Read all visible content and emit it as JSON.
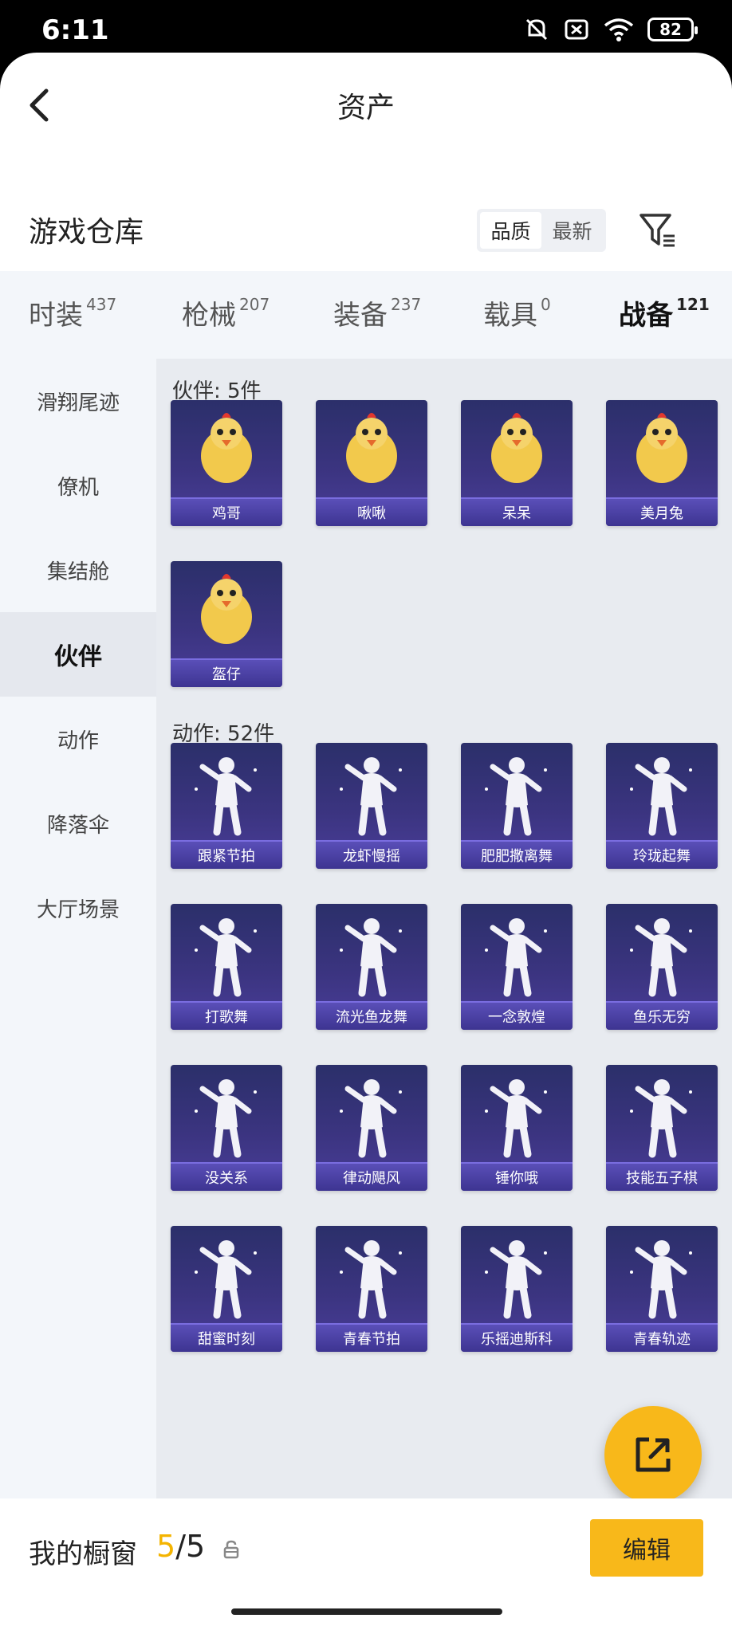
{
  "status": {
    "time": "6:11",
    "battery": "82"
  },
  "header": {
    "title": "资产"
  },
  "warehouse": {
    "title": "游戏仓库",
    "sort_options": [
      "品质",
      "最新"
    ],
    "active_sort": "品质"
  },
  "tabs": [
    {
      "label": "时装",
      "count": "437"
    },
    {
      "label": "枪械",
      "count": "207"
    },
    {
      "label": "装备",
      "count": "237"
    },
    {
      "label": "载具",
      "count": "0"
    },
    {
      "label": "战备",
      "count": "121"
    }
  ],
  "active_tab": "战备",
  "sidebar": {
    "items": [
      "滑翔尾迹",
      "僚机",
      "集结舱",
      "伙伴",
      "动作",
      "降落伞",
      "大厅场景"
    ],
    "active": "伙伴"
  },
  "groups": [
    {
      "title": "伙伴: 5件",
      "items": [
        "鸡哥",
        "啾啾",
        "呆呆",
        "美月兔",
        "盔仔"
      ]
    },
    {
      "title": "动作: 52件",
      "items": [
        "跟紧节拍",
        "龙虾慢摇",
        "肥肥撒离舞",
        "玲珑起舞",
        "打歌舞",
        "流光鱼龙舞",
        "一念敦煌",
        "鱼乐无穷",
        "没关系",
        "律动飓风",
        "锤你哦",
        "技能五子棋",
        "甜蜜时刻",
        "青春节拍",
        "乐摇迪斯科",
        "青春轨迹"
      ]
    }
  ],
  "showcase": {
    "label": "我的橱窗",
    "current": "5",
    "total": "/5"
  },
  "edit_button": "编辑",
  "colors": {
    "accent": "#f8b81a",
    "card": "#3b3480"
  }
}
